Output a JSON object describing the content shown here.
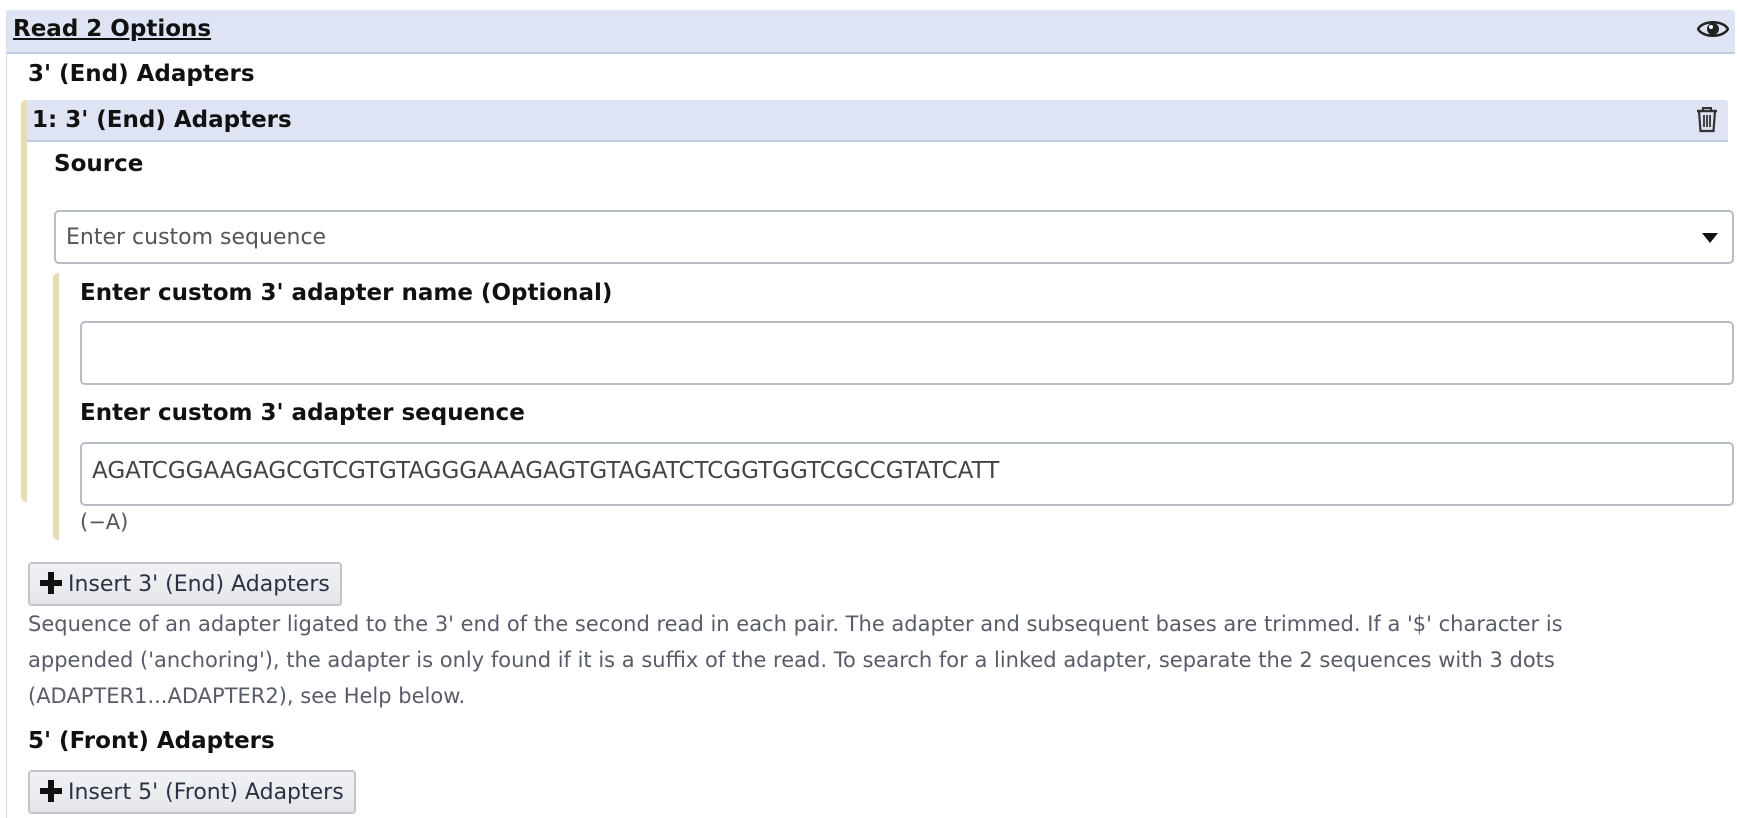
{
  "section": {
    "title": "Read 2 Options",
    "icon": "eye-icon"
  },
  "adapters3": {
    "label": "3' (End) Adapters",
    "repeat": {
      "title": "1: 3' (End) Adapters",
      "delete_icon": "trash-icon",
      "source": {
        "label": "Source",
        "value": "Enter custom sequence"
      },
      "name_field": {
        "label": "Enter custom 3' adapter name (Optional)",
        "value": ""
      },
      "sequence_field": {
        "label": "Enter custom 3' adapter sequence",
        "value": "AGATCGGAAGAGCGTCGTGTAGGGAAAGAGTGTAGATCTCGGTGGTCGCCGTATCATT",
        "note": "(−A)"
      }
    },
    "insert_button": "Insert 3' (End) Adapters",
    "help_lines": [
      "Sequence of an adapter ligated to the 3' end of the second read in each pair. The adapter and subsequent bases are trimmed. If a '$' character is",
      "appended ('anchoring'), the adapter is only found if it is a suffix of the read. To search for a linked adapter, separate the 2 sequences with 3 dots",
      "(ADAPTER1...ADAPTER2), see Help below."
    ]
  },
  "adapters5": {
    "label": "5' (Front) Adapters",
    "insert_button": "Insert 5' (Front) Adapters"
  }
}
